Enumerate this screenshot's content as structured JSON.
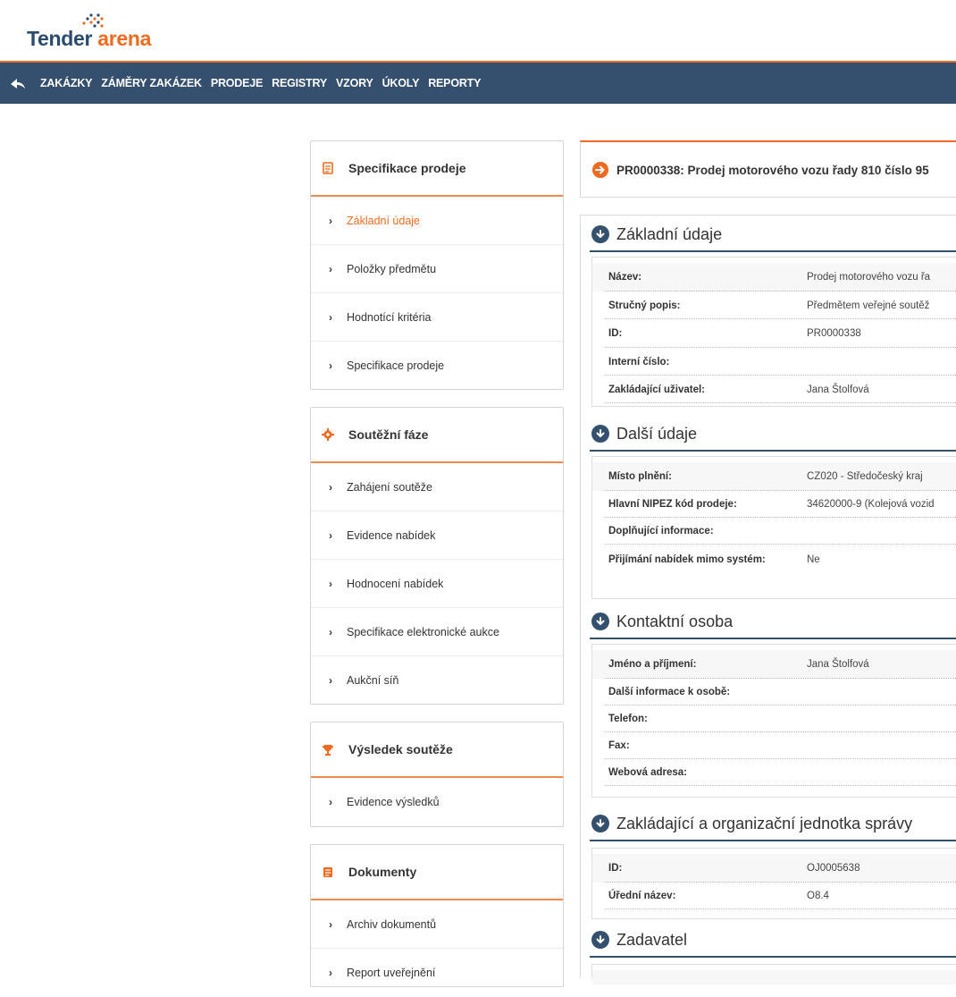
{
  "brand": {
    "word1": "Tender",
    "word2": "arena"
  },
  "nav": {
    "items": [
      "ZAKÁZKY",
      "ZÁMĚRY ZAKÁZEK",
      "PRODEJE",
      "REGISTRY",
      "VZORY",
      "ÚKOLY",
      "REPORTY"
    ]
  },
  "panels": [
    {
      "title": "Specifikace prodeje",
      "icon": "document-icon",
      "items": [
        {
          "label": "Základní údaje",
          "active": true
        },
        {
          "label": "Položky předmětu"
        },
        {
          "label": "Hodnotící kritéria"
        },
        {
          "label": "Specifikace prodeje"
        }
      ]
    },
    {
      "title": "Soutěžní fáze",
      "icon": "gear-icon",
      "items": [
        {
          "label": "Zahájení soutěže"
        },
        {
          "label": "Evidence nabídek"
        },
        {
          "label": "Hodnocení nabídek"
        },
        {
          "label": "Specifikace elektronické aukce"
        },
        {
          "label": "Aukční síň"
        }
      ]
    },
    {
      "title": "Výsledek soutěže",
      "icon": "trophy-icon",
      "items": [
        {
          "label": "Evidence výsledků"
        }
      ]
    },
    {
      "title": "Dokumenty",
      "icon": "folder-icon",
      "items": [
        {
          "label": "Archiv dokumentů"
        },
        {
          "label": "Report uveřejnění"
        }
      ]
    }
  ],
  "record_title": "PR0000338: Prodej motorového vozu řady 810 číslo 95",
  "sections": [
    {
      "title": "Základní údaje",
      "rows": [
        {
          "k": "Název:",
          "v": "Prodej motorového vozu řa"
        },
        {
          "k": "Stručný popis:",
          "v": "Předmětem veřejné soutěž"
        },
        {
          "k": "ID:",
          "v": "PR0000338"
        },
        {
          "k": "Interní číslo:",
          "v": ""
        },
        {
          "k": "Zakládající uživatel:",
          "v": "Jana Štolfová"
        }
      ]
    },
    {
      "title": "Další údaje",
      "rows": [
        {
          "k": "Místo plnění:",
          "v": "CZ020 - Středočeský kraj"
        },
        {
          "k": "Hlavní NIPEZ kód prodeje:",
          "v": "34620000-9 (Kolejová vozid"
        },
        {
          "k": "Doplňující informace:",
          "v": ""
        },
        {
          "k": "Přijímání nabídek mimo systém:",
          "v": "Ne"
        }
      ]
    },
    {
      "title": "Kontaktní osoba",
      "rows": [
        {
          "k": "Jméno a příjmení:",
          "v": "Jana Štolfová"
        },
        {
          "k": "Další informace k osobě:",
          "v": ""
        },
        {
          "k": "Telefon:",
          "v": ""
        },
        {
          "k": "Fax:",
          "v": ""
        },
        {
          "k": "Webová adresa:",
          "v": ""
        }
      ]
    },
    {
      "title": "Zakládající a organizační jednotka správy",
      "rows": [
        {
          "k": "ID:",
          "v": "OJ0005638"
        },
        {
          "k": "Úřední název:",
          "v": "O8.4"
        }
      ]
    },
    {
      "title": "Zadavatel",
      "rows": []
    }
  ],
  "colors": {
    "accent": "#ee6b1f",
    "navbar": "#34506e"
  }
}
